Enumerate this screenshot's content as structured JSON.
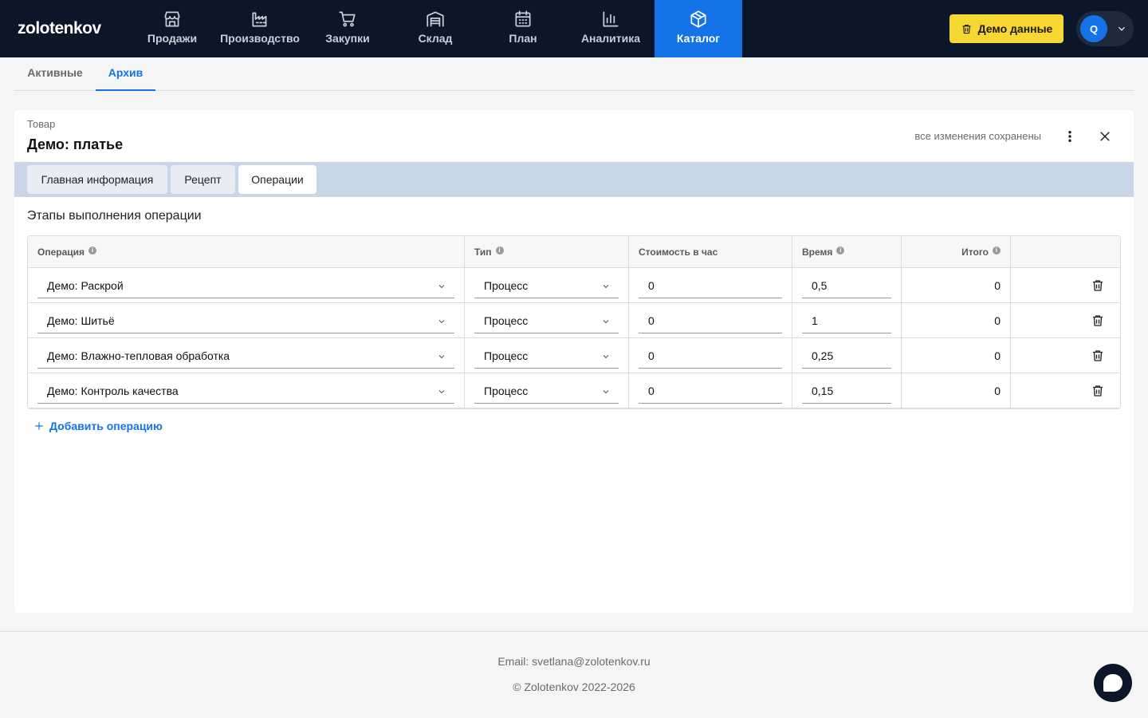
{
  "app": {
    "logo": "zolotenkov"
  },
  "nav": [
    {
      "label": "Продажи",
      "icon": "store-icon"
    },
    {
      "label": "Производство",
      "icon": "factory-icon"
    },
    {
      "label": "Закупки",
      "icon": "cart-icon"
    },
    {
      "label": "Склад",
      "icon": "warehouse-icon"
    },
    {
      "label": "План",
      "icon": "calendar-icon"
    },
    {
      "label": "Аналитика",
      "icon": "chart-icon"
    },
    {
      "label": "Каталог",
      "icon": "box-icon",
      "active": true
    }
  ],
  "header": {
    "demo_label": "Демо данные",
    "user_initial": "Q"
  },
  "subtabs": [
    {
      "label": "Активные"
    },
    {
      "label": "Архив",
      "active": true
    }
  ],
  "card": {
    "kicker": "Товар",
    "title": "Демо: платье",
    "saved": "все изменения сохранены",
    "tabs": [
      {
        "label": "Главная информация"
      },
      {
        "label": "Рецепт"
      },
      {
        "label": "Операции",
        "active": true
      }
    ],
    "section_title": "Этапы выполнения операции"
  },
  "table": {
    "columns": {
      "operation": "Операция",
      "type": "Тип",
      "cost": "Стоимость в час",
      "time": "Время",
      "total": "Итого"
    },
    "rows": [
      {
        "operation": "Демо: Раскрой",
        "type": "Процесс",
        "cost": "0",
        "time": "0,5",
        "total": "0"
      },
      {
        "operation": "Демо: Шитьё",
        "type": "Процесс",
        "cost": "0",
        "time": "1",
        "total": "0"
      },
      {
        "operation": "Демо: Влажно-тепловая обработка",
        "type": "Процесс",
        "cost": "0",
        "time": "0,25",
        "total": "0"
      },
      {
        "operation": "Демо: Контроль качества",
        "type": "Процесс",
        "cost": "0",
        "time": "0,15",
        "total": "0"
      }
    ],
    "add_label": "Добавить операцию"
  },
  "footer": {
    "email": "Email: svetlana@zolotenkov.ru",
    "copyright": "© Zolotenkov 2022-2026"
  },
  "colors": {
    "nav_bg": "#0b1628",
    "accent": "#1473e6",
    "demo_button": "#f7d731",
    "tabbar": "#c9d6e8"
  }
}
